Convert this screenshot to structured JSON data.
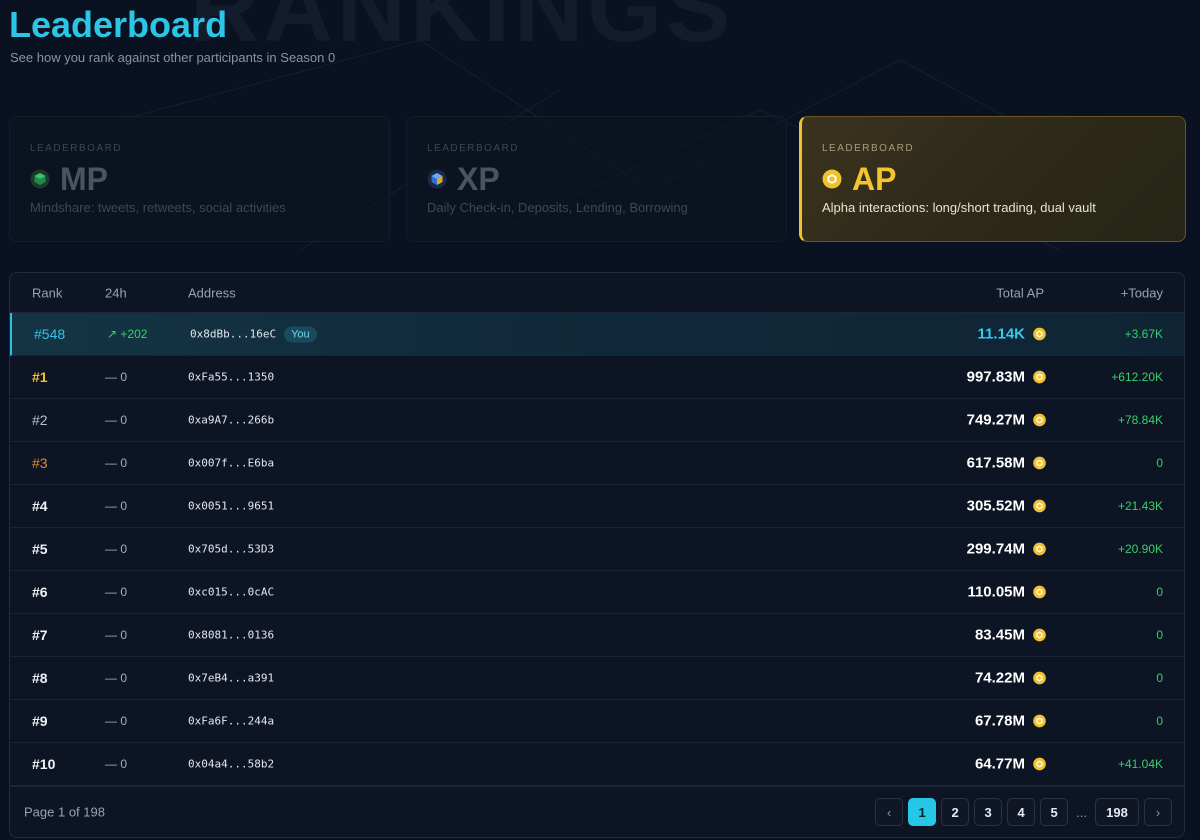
{
  "header": {
    "watermark": "RANKINGS",
    "title": "Leaderboard",
    "subtitle": "See how you rank against other participants in Season 0"
  },
  "cards": [
    {
      "kicker": "LEADERBOARD",
      "title": "MP",
      "desc": "Mindshare: tweets, retweets, social activities",
      "icon": "green-cube-icon",
      "color": "#1f8a4c"
    },
    {
      "kicker": "LEADERBOARD",
      "title": "XP",
      "desc": "Daily Check-in, Deposits, Lending, Borrowing",
      "icon": "blue-cube-icon",
      "color": "#2a6fd6"
    },
    {
      "kicker": "LEADERBOARD",
      "title": "AP",
      "desc": "Alpha interactions: long/short trading, dual vault",
      "icon": "gold-coin-icon",
      "color": "#f2c12e"
    }
  ],
  "table": {
    "columns": {
      "rank": "Rank",
      "change": "24h",
      "address": "Address",
      "total": "Total AP",
      "today": "+Today"
    },
    "you_label": "You",
    "rows": [
      {
        "rank": "#548",
        "change": "↗ +202",
        "address": "0x8dBb...16eC",
        "total": "11.14K",
        "today": "+3.67K"
      },
      {
        "rank": "#1",
        "change": "— 0",
        "address": "0xFa55...1350",
        "total": "997.83M",
        "today": "+612.20K"
      },
      {
        "rank": "#2",
        "change": "— 0",
        "address": "0xa9A7...266b",
        "total": "749.27M",
        "today": "+78.84K"
      },
      {
        "rank": "#3",
        "change": "— 0",
        "address": "0x007f...E6ba",
        "total": "617.58M",
        "today": "0"
      },
      {
        "rank": "#4",
        "change": "— 0",
        "address": "0x0051...9651",
        "total": "305.52M",
        "today": "+21.43K"
      },
      {
        "rank": "#5",
        "change": "— 0",
        "address": "0x705d...53D3",
        "total": "299.74M",
        "today": "+20.90K"
      },
      {
        "rank": "#6",
        "change": "— 0",
        "address": "0xc015...0cAC",
        "total": "110.05M",
        "today": "0"
      },
      {
        "rank": "#7",
        "change": "— 0",
        "address": "0x8081...0136",
        "total": "83.45M",
        "today": "0"
      },
      {
        "rank": "#8",
        "change": "— 0",
        "address": "0x7eB4...a391",
        "total": "74.22M",
        "today": "0"
      },
      {
        "rank": "#9",
        "change": "— 0",
        "address": "0xFa6F...244a",
        "total": "67.78M",
        "today": "0"
      },
      {
        "rank": "#10",
        "change": "— 0",
        "address": "0x04a4...58b2",
        "total": "64.77M",
        "today": "+41.04K"
      }
    ]
  },
  "pagination": {
    "info": "Page 1 of 198",
    "prev": "‹",
    "next": "›",
    "pages": [
      "1",
      "2",
      "3",
      "4",
      "5"
    ],
    "ellipsis": "...",
    "last": "198",
    "current": "1"
  },
  "colors": {
    "accent": "#25c6e6",
    "gold": "#f2c12e",
    "positive": "#36d06b"
  }
}
